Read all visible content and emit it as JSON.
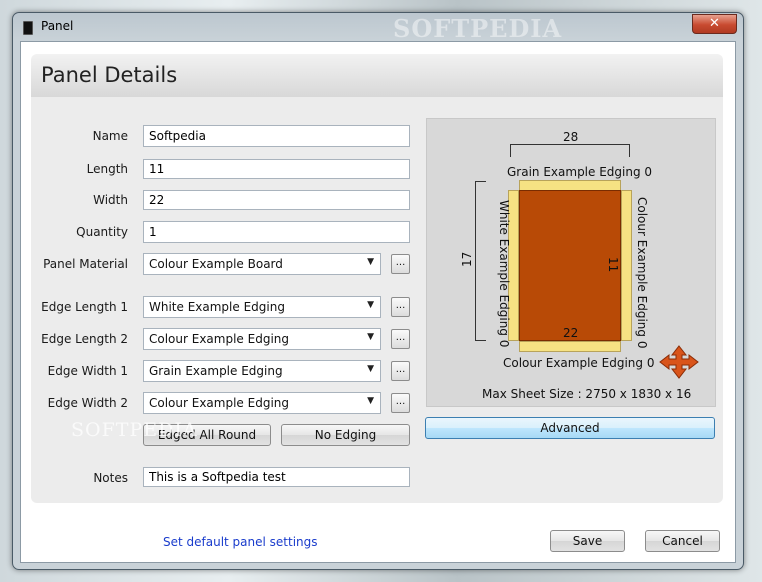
{
  "window": {
    "title": "Panel",
    "close_glyph": "✕",
    "watermark": "SOFTPEDIA"
  },
  "header": {
    "title": "Panel Details"
  },
  "form": {
    "name_label": "Name",
    "name_value": "Softpedia",
    "length_label": "Length",
    "length_value": "11",
    "width_label": "Width",
    "width_value": "22",
    "quantity_label": "Quantity",
    "quantity_value": "1",
    "material_label": "Panel Material",
    "material_value": "Colour Example Board",
    "edge_length1_label": "Edge Length 1",
    "edge_length1_value": "White Example Edging",
    "edge_length2_label": "Edge Length 2",
    "edge_length2_value": "Colour Example Edging",
    "edge_width1_label": "Edge Width 1",
    "edge_width1_value": "Grain Example Edging",
    "edge_width2_label": "Edge Width 2",
    "edge_width2_value": "Colour Example Edging",
    "browse_label": "...",
    "edged_all_round_label": "Edged All Round",
    "no_edging_label": "No Edging",
    "notes_label": "Notes",
    "notes_value": "This is a Softpedia test"
  },
  "preview": {
    "top_dimension": "28",
    "top_edge_label": "Grain Example Edging 0",
    "left_dimension": "17",
    "left_edge_label": "White Example Edging 0",
    "right_edge_label": "Colour Example Edging 0",
    "inner_right_dimension": "11",
    "inner_bottom_dimension": "22",
    "bottom_edge_label": "Colour Example Edging 0",
    "max_sheet_size": "Max Sheet Size : 2750 x 1830 x 16",
    "board_color": "#b84a06",
    "edging_color": "#f6e283",
    "rotate_icon": "move-arrows-icon"
  },
  "advanced_label": "Advanced",
  "footer": {
    "default_link": "Set default panel settings",
    "save_label": "Save",
    "cancel_label": "Cancel"
  }
}
